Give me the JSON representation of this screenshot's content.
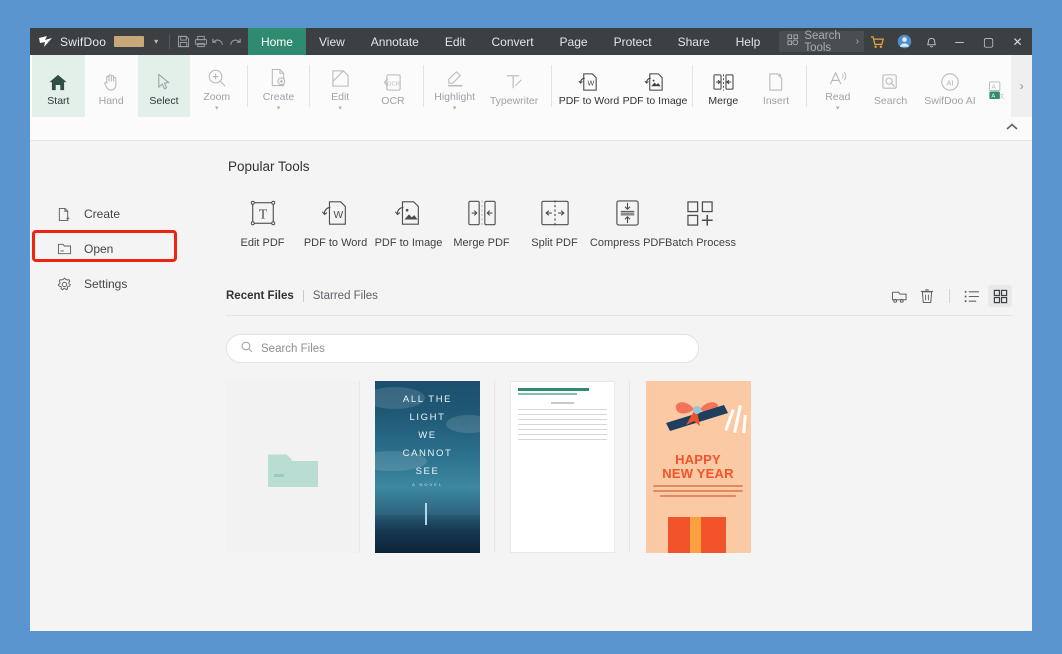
{
  "titlebar": {
    "brand": "SwifDoo",
    "brand_redacted": true,
    "dropdown_caret": "▾",
    "icons": [
      {
        "name": "save-icon",
        "label": "Save"
      },
      {
        "name": "print-icon",
        "label": "Print"
      },
      {
        "name": "undo-icon",
        "label": "Undo"
      },
      {
        "name": "redo-icon",
        "label": "Redo"
      }
    ],
    "tabs": [
      {
        "label": "Home",
        "active": true
      },
      {
        "label": "View",
        "active": false
      },
      {
        "label": "Annotate",
        "active": false
      },
      {
        "label": "Edit",
        "active": false
      },
      {
        "label": "Convert",
        "active": false
      },
      {
        "label": "Page",
        "active": false
      },
      {
        "label": "Protect",
        "active": false
      },
      {
        "label": "Share",
        "active": false
      },
      {
        "label": "Help",
        "active": false
      }
    ],
    "search_tools": "Search Tools",
    "search_tools_chevron": "›",
    "right_icons": [
      {
        "name": "cart-icon",
        "label": "Cart"
      },
      {
        "name": "account-icon",
        "label": "Account"
      },
      {
        "name": "bell-icon",
        "label": "Notifications"
      }
    ],
    "window_controls": {
      "minimize": "─",
      "maximize": "▢",
      "close": "✕"
    },
    "active_tab_color": "#2e8b70",
    "bar_color": "#3c4043"
  },
  "ribbon": {
    "items": [
      {
        "label": "Start",
        "icon": "home-icon",
        "selected": true,
        "dark": true,
        "dropdown": false
      },
      {
        "label": "Hand",
        "icon": "hand-icon",
        "selected": false,
        "dark": false,
        "dropdown": false
      },
      {
        "label": "Select",
        "icon": "cursor-icon",
        "selected": true,
        "dark": false,
        "dropdown": false
      },
      {
        "label": "Zoom",
        "icon": "zoom-in-icon",
        "selected": false,
        "dark": false,
        "dropdown": true
      },
      {
        "label": "Create",
        "icon": "file-plus-icon",
        "selected": false,
        "dark": false,
        "dropdown": true
      },
      {
        "label": "Edit",
        "icon": "edit-pencil-icon",
        "selected": false,
        "dark": false,
        "dropdown": true
      },
      {
        "label": "OCR",
        "icon": "ocr-icon",
        "selected": false,
        "dark": false,
        "dropdown": false
      },
      {
        "label": "Highlight",
        "icon": "highlighter-icon",
        "selected": false,
        "dark": false,
        "dropdown": true
      },
      {
        "label": "Typewriter",
        "icon": "typewriter-icon",
        "selected": false,
        "dark": false,
        "dropdown": false
      },
      {
        "label": "PDF to Word",
        "icon": "pdf-to-word-icon",
        "selected": false,
        "dark": true,
        "dropdown": false
      },
      {
        "label": "PDF to Image",
        "icon": "pdf-to-image-icon",
        "selected": false,
        "dark": true,
        "dropdown": false
      },
      {
        "label": "Merge",
        "icon": "merge-icon",
        "selected": false,
        "dark": true,
        "dropdown": false
      },
      {
        "label": "Insert",
        "icon": "insert-page-icon",
        "selected": false,
        "dark": false,
        "dropdown": false
      },
      {
        "label": "Read",
        "icon": "read-aloud-icon",
        "selected": false,
        "dark": false,
        "dropdown": true
      },
      {
        "label": "Search",
        "icon": "search-doc-icon",
        "selected": false,
        "dark": false,
        "dropdown": false
      },
      {
        "label": "SwifDoo AI",
        "icon": "ai-circle-icon",
        "selected": false,
        "dark": false,
        "dropdown": false
      },
      {
        "label": "",
        "icon": "translate-icon",
        "selected": false,
        "dark": false,
        "dropdown": false
      }
    ],
    "more_chevron": "›",
    "collapse_chevron": "^"
  },
  "sidebar": {
    "items": [
      {
        "label": "Create",
        "icon": "file-plus-icon",
        "highlighted": false
      },
      {
        "label": "Open",
        "icon": "folder-icon",
        "highlighted": true
      },
      {
        "label": "Settings",
        "icon": "gear-icon",
        "highlighted": false
      }
    ],
    "highlight_color": "#ee2411"
  },
  "main": {
    "popular_tools_title": "Popular Tools",
    "tools": [
      {
        "label": "Edit PDF",
        "icon": "text-box-icon"
      },
      {
        "label": "PDF to Word",
        "icon": "pdf-to-word-icon"
      },
      {
        "label": "PDF to Image",
        "icon": "pdf-to-image-icon"
      },
      {
        "label": "Merge PDF",
        "icon": "merge-pdf-icon"
      },
      {
        "label": "Split PDF",
        "icon": "split-pdf-icon"
      },
      {
        "label": "Compress PDF",
        "icon": "compress-pdf-icon"
      },
      {
        "label": "Batch Process",
        "icon": "batch-process-icon"
      }
    ],
    "files": {
      "tab_recent": "Recent Files",
      "tab_starred": "Starred Files",
      "actions": [
        {
          "name": "open-file-icon",
          "label": "Open File"
        },
        {
          "name": "trash-icon",
          "label": "Delete"
        },
        {
          "name": "list-view-icon",
          "label": "List View"
        },
        {
          "name": "grid-view-icon",
          "label": "Grid View",
          "active": true
        }
      ],
      "search_placeholder": "Search Files",
      "thumbnails": [
        {
          "name": "open-folder-placeholder",
          "kind": "placeholder"
        },
        {
          "name": "book-cover-thumbnail",
          "kind": "book",
          "lines": [
            "ALL THE",
            "LIGHT",
            "WE",
            "CANNOT",
            "SEE"
          ],
          "subtitle": "A NOVEL"
        },
        {
          "name": "document-thumbnail",
          "kind": "document"
        },
        {
          "name": "new-year-poster-thumbnail",
          "kind": "poster",
          "title_line1": "HAPPY",
          "title_line2": "NEW YEAR"
        }
      ]
    }
  }
}
